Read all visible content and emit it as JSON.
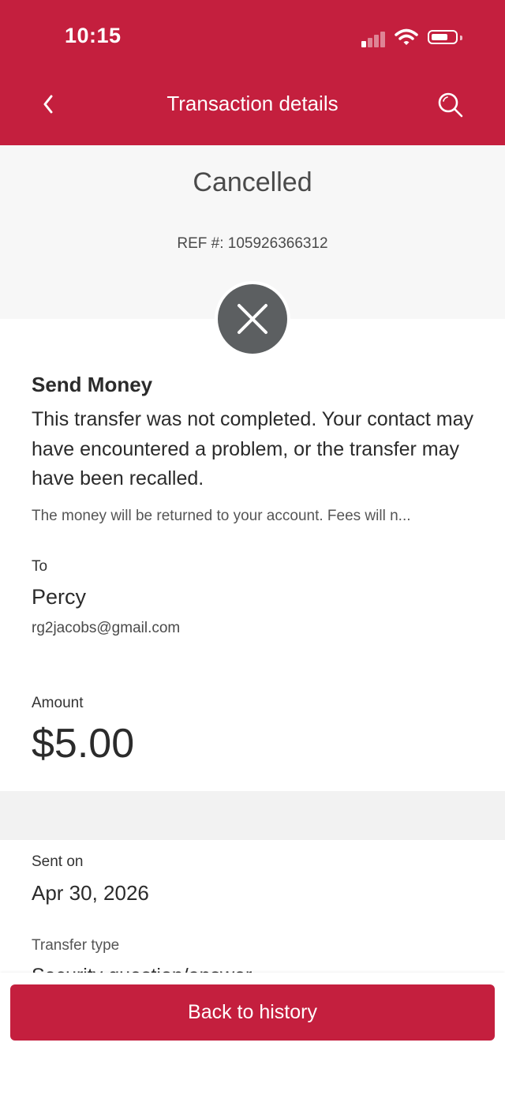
{
  "status_bar": {
    "time": "10:15"
  },
  "header": {
    "title": "Transaction details",
    "back_icon": "chevron-left-icon",
    "search_icon": "search-icon",
    "color": "#c41f3e"
  },
  "status": {
    "text": "Cancelled",
    "ref": "REF #: 105926366312",
    "icon": "close-icon"
  },
  "transfer": {
    "type": "Send Money",
    "message": "This transfer was not completed. Your contact may have encountered a problem, or the transfer may have been recalled.",
    "note": "The money will be returned to your account. Fees will n..."
  },
  "recipient": {
    "label": "To",
    "name": "Percy",
    "email": "rg2jacobs@gmail.com"
  },
  "amount": {
    "label": "Amount",
    "value": "$5.00"
  },
  "sent": {
    "label": "Sent on",
    "date": "Apr 30, 2026"
  },
  "transfer_type": {
    "label": "Transfer type",
    "value": "Security question/answer"
  },
  "footer": {
    "button_label": "Back to history"
  }
}
